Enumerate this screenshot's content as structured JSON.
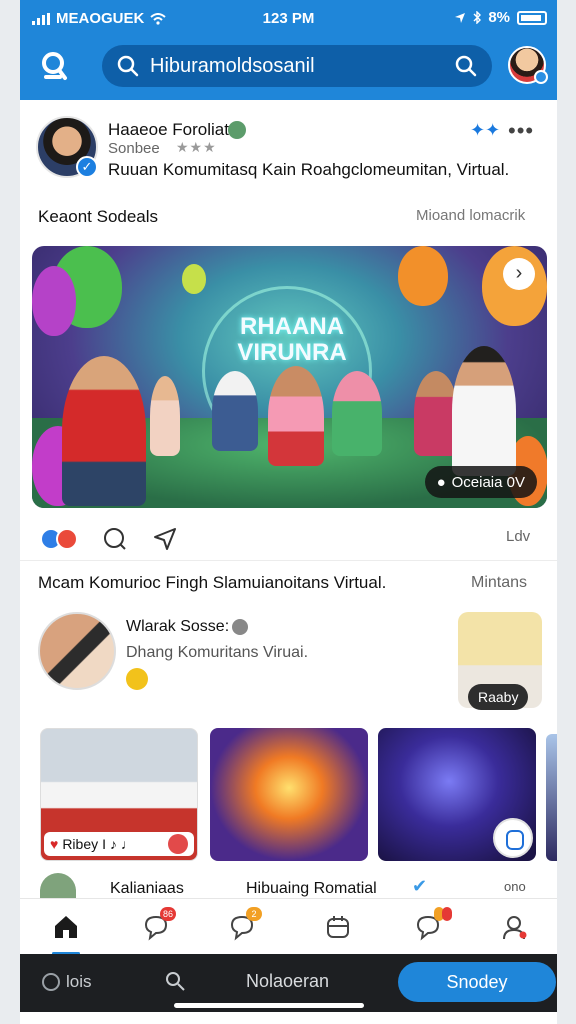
{
  "status_bar": {
    "carrier": "MEAOGUEK",
    "time": "123 PM",
    "battery": "8%"
  },
  "header": {
    "search_text": "Hiburamoldsosanil"
  },
  "post": {
    "author": "Haaeoe Foroliat",
    "subtitle": "Sonbee",
    "stars": "★★★",
    "description": "Ruuan Komumitasq Kain Roahgclomeumitan, Virtual."
  },
  "section": {
    "title": "Keaont Sodeals",
    "link": "Mioand lomacrik"
  },
  "hero": {
    "title_line1": "RHAANA",
    "title_line2": "VIRUNRA",
    "chip_label": "Oceiaia 0V",
    "next_icon": "chevron-right-icon"
  },
  "actions": {
    "right_label": "Ldv"
  },
  "caption": {
    "text": "Mcam Komurioc Fingh Slamuianoitans Virtual.",
    "right": "Mintans"
  },
  "member": {
    "name": "Wlarak Sosse:",
    "description": "Dhang Komuritans Viruai.",
    "side_chip": "Raaby"
  },
  "thumbs": {
    "chip_text": "Ribey",
    "chip_extra": "I ♪ ♩"
  },
  "peek": {
    "name": "Kalianiaas",
    "title": "Hibuaing Romatial",
    "more": "ono"
  },
  "tabs": {
    "badge_messages": "86",
    "badge_chat": "2"
  },
  "bottom_bar": {
    "left_label": "lois",
    "center_label": "Nolaoeran",
    "button_label": "Snodey"
  },
  "colors": {
    "brand": "#1f86d9",
    "dark": "#1d1f22"
  }
}
